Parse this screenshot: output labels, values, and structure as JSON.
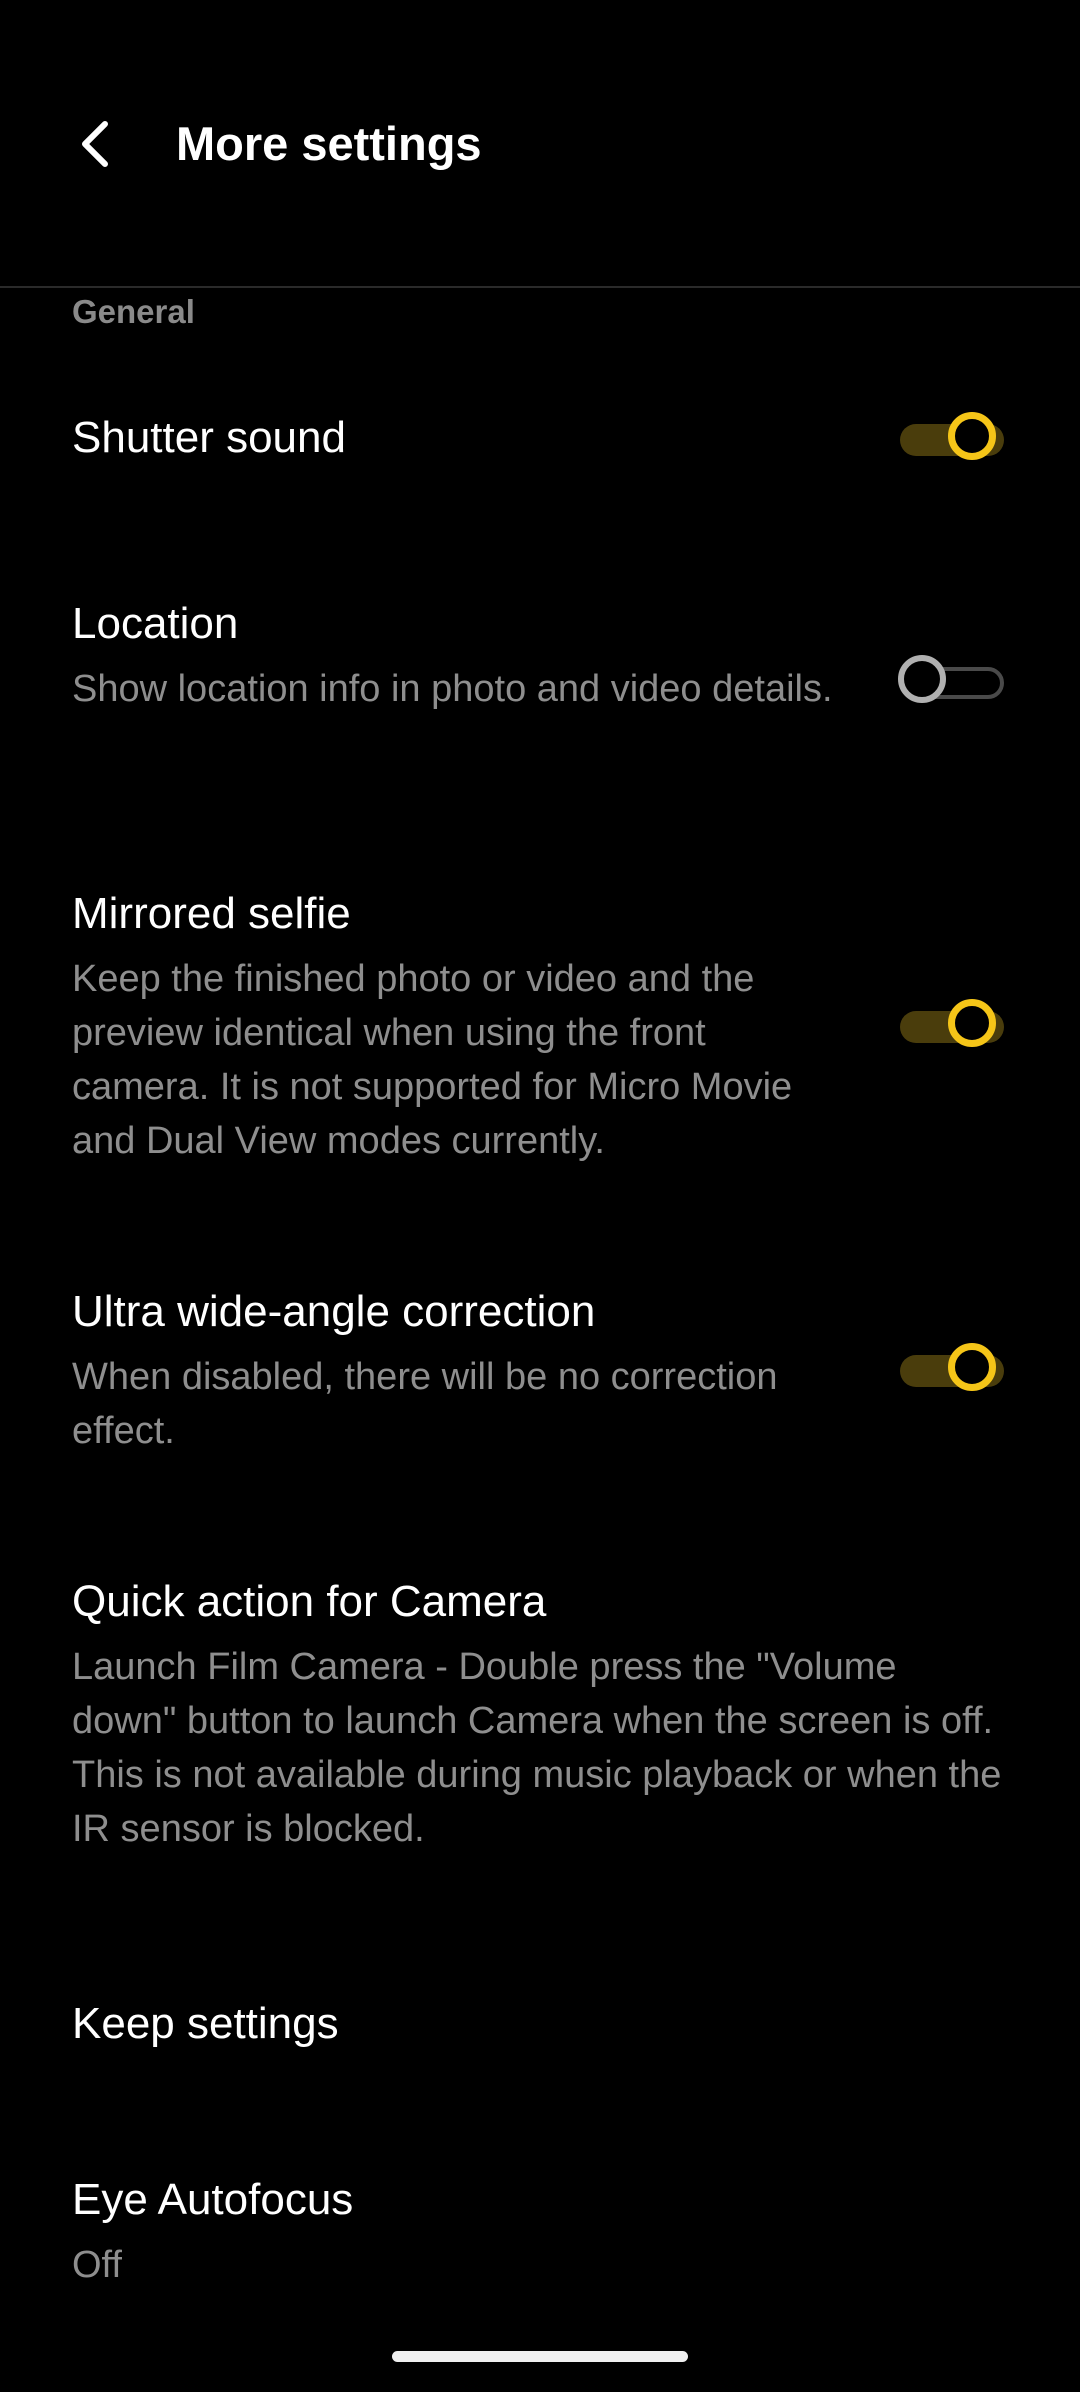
{
  "header": {
    "title": "More settings"
  },
  "section": {
    "label": "General"
  },
  "settings": {
    "shutter_sound": {
      "title": "Shutter sound",
      "enabled": true
    },
    "location": {
      "title": "Location",
      "description": "Show location info in photo and video details.",
      "enabled": false
    },
    "mirrored_selfie": {
      "title": "Mirrored selfie",
      "description": "Keep the finished photo or video and the preview identical when using the front camera. It is not supported for Micro Movie and Dual View modes currently.",
      "enabled": true
    },
    "ultra_wide": {
      "title": "Ultra wide-angle correction",
      "description": "When disabled, there will be no correction effect.",
      "enabled": true
    },
    "quick_action": {
      "title": "Quick action for Camera",
      "description": "Launch Film Camera - Double press the \"Volume down\" button to launch Camera when the screen is off. This is not available during music playback or when the IR sensor is blocked."
    },
    "keep_settings": {
      "title": "Keep settings"
    },
    "eye_autofocus": {
      "title": "Eye Autofocus",
      "value": "Off"
    }
  },
  "colors": {
    "accent": "#f5c518",
    "accent_track": "#4a3d0c",
    "background": "#000000",
    "secondary_text": "#8e8e8e"
  },
  "icons": {
    "back": "chevron-left-icon"
  }
}
